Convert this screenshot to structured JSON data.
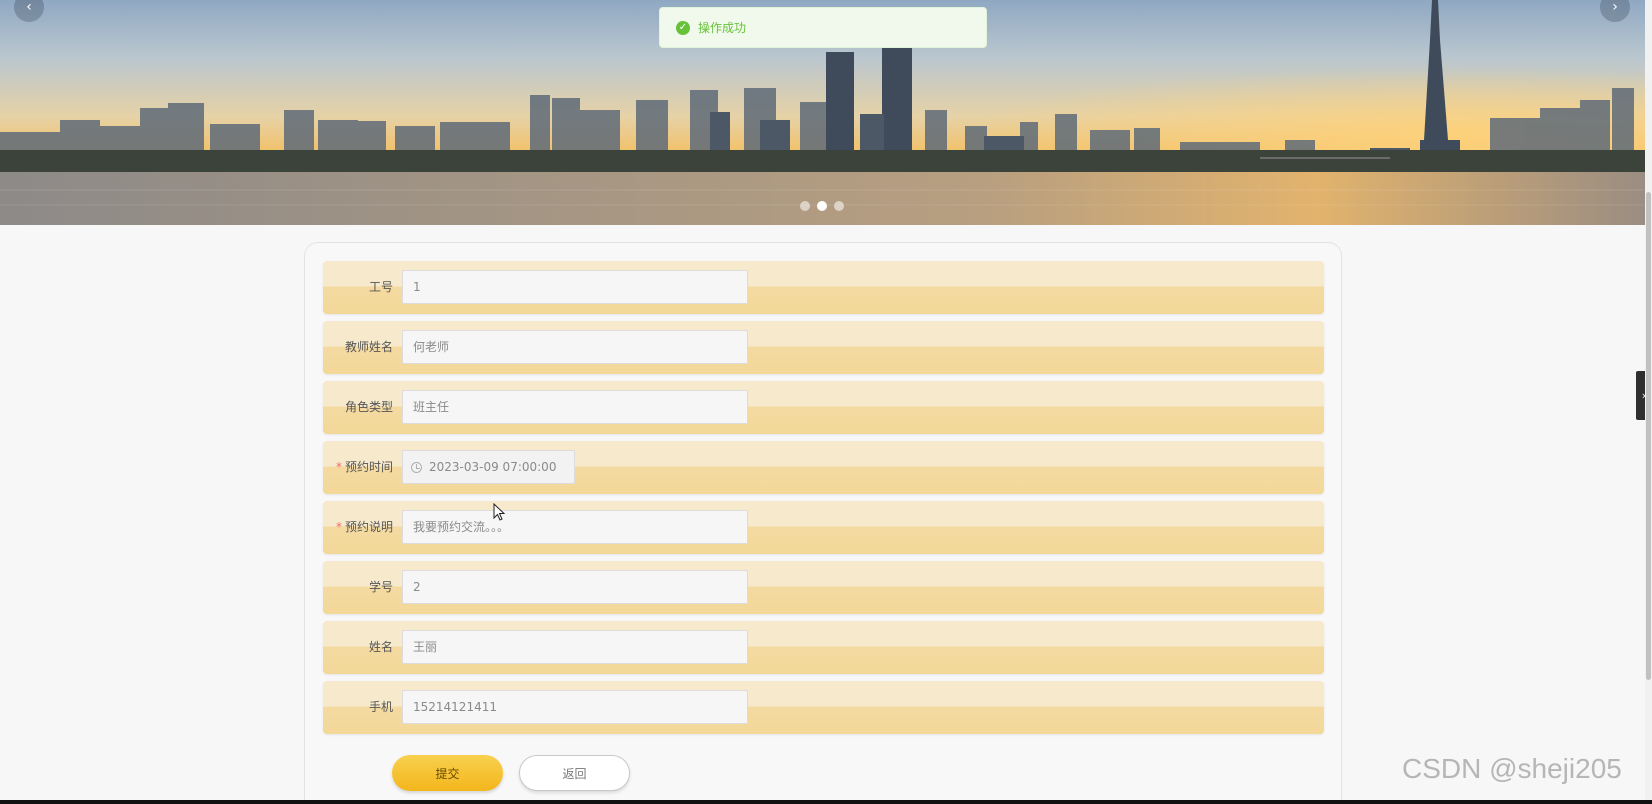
{
  "carousel": {
    "prev_icon": "‹",
    "next_icon": "›"
  },
  "toast": {
    "message": "操作成功",
    "icon": "✓",
    "color": "#67c23a"
  },
  "form": {
    "fields": [
      {
        "label": "工号",
        "value": "1",
        "required": false
      },
      {
        "label": "教师姓名",
        "value": "何老师",
        "required": false
      },
      {
        "label": "角色类型",
        "value": "班主任",
        "required": false
      },
      {
        "label": "预约时间",
        "value": "2023-03-09 07:00:00",
        "required": true
      },
      {
        "label": "预约说明",
        "value": "我要预约交流。。。",
        "required": true
      },
      {
        "label": "学号",
        "value": "2",
        "required": false
      },
      {
        "label": "姓名",
        "value": "王丽",
        "required": false
      },
      {
        "label": "手机",
        "value": "15214121411",
        "required": false
      }
    ],
    "required_mark": "*",
    "submit_label": "提交",
    "back_label": "返回"
  },
  "side_tab": {
    "icon": "›"
  },
  "watermark": {
    "text": "CSDN @sheji205"
  }
}
